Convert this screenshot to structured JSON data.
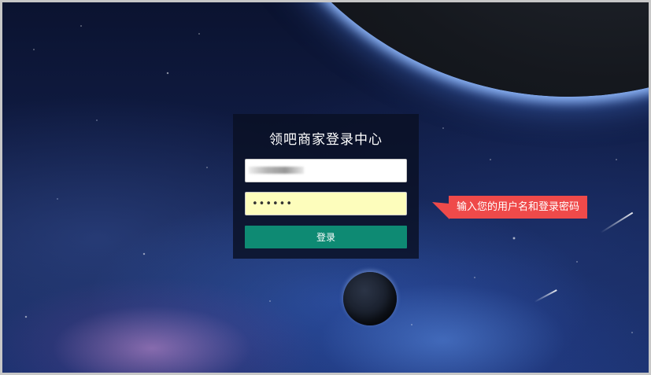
{
  "login": {
    "title": "领吧商家登录中心",
    "username_value": "",
    "password_value": "••••••",
    "submit_label": "登录"
  },
  "tooltip": {
    "text": "输入您的用户名和登录密码"
  },
  "colors": {
    "button": "#0e8a73",
    "tooltip": "#ef4a4a",
    "password_field": "#fdfdbc",
    "panel": "#0a1023"
  }
}
